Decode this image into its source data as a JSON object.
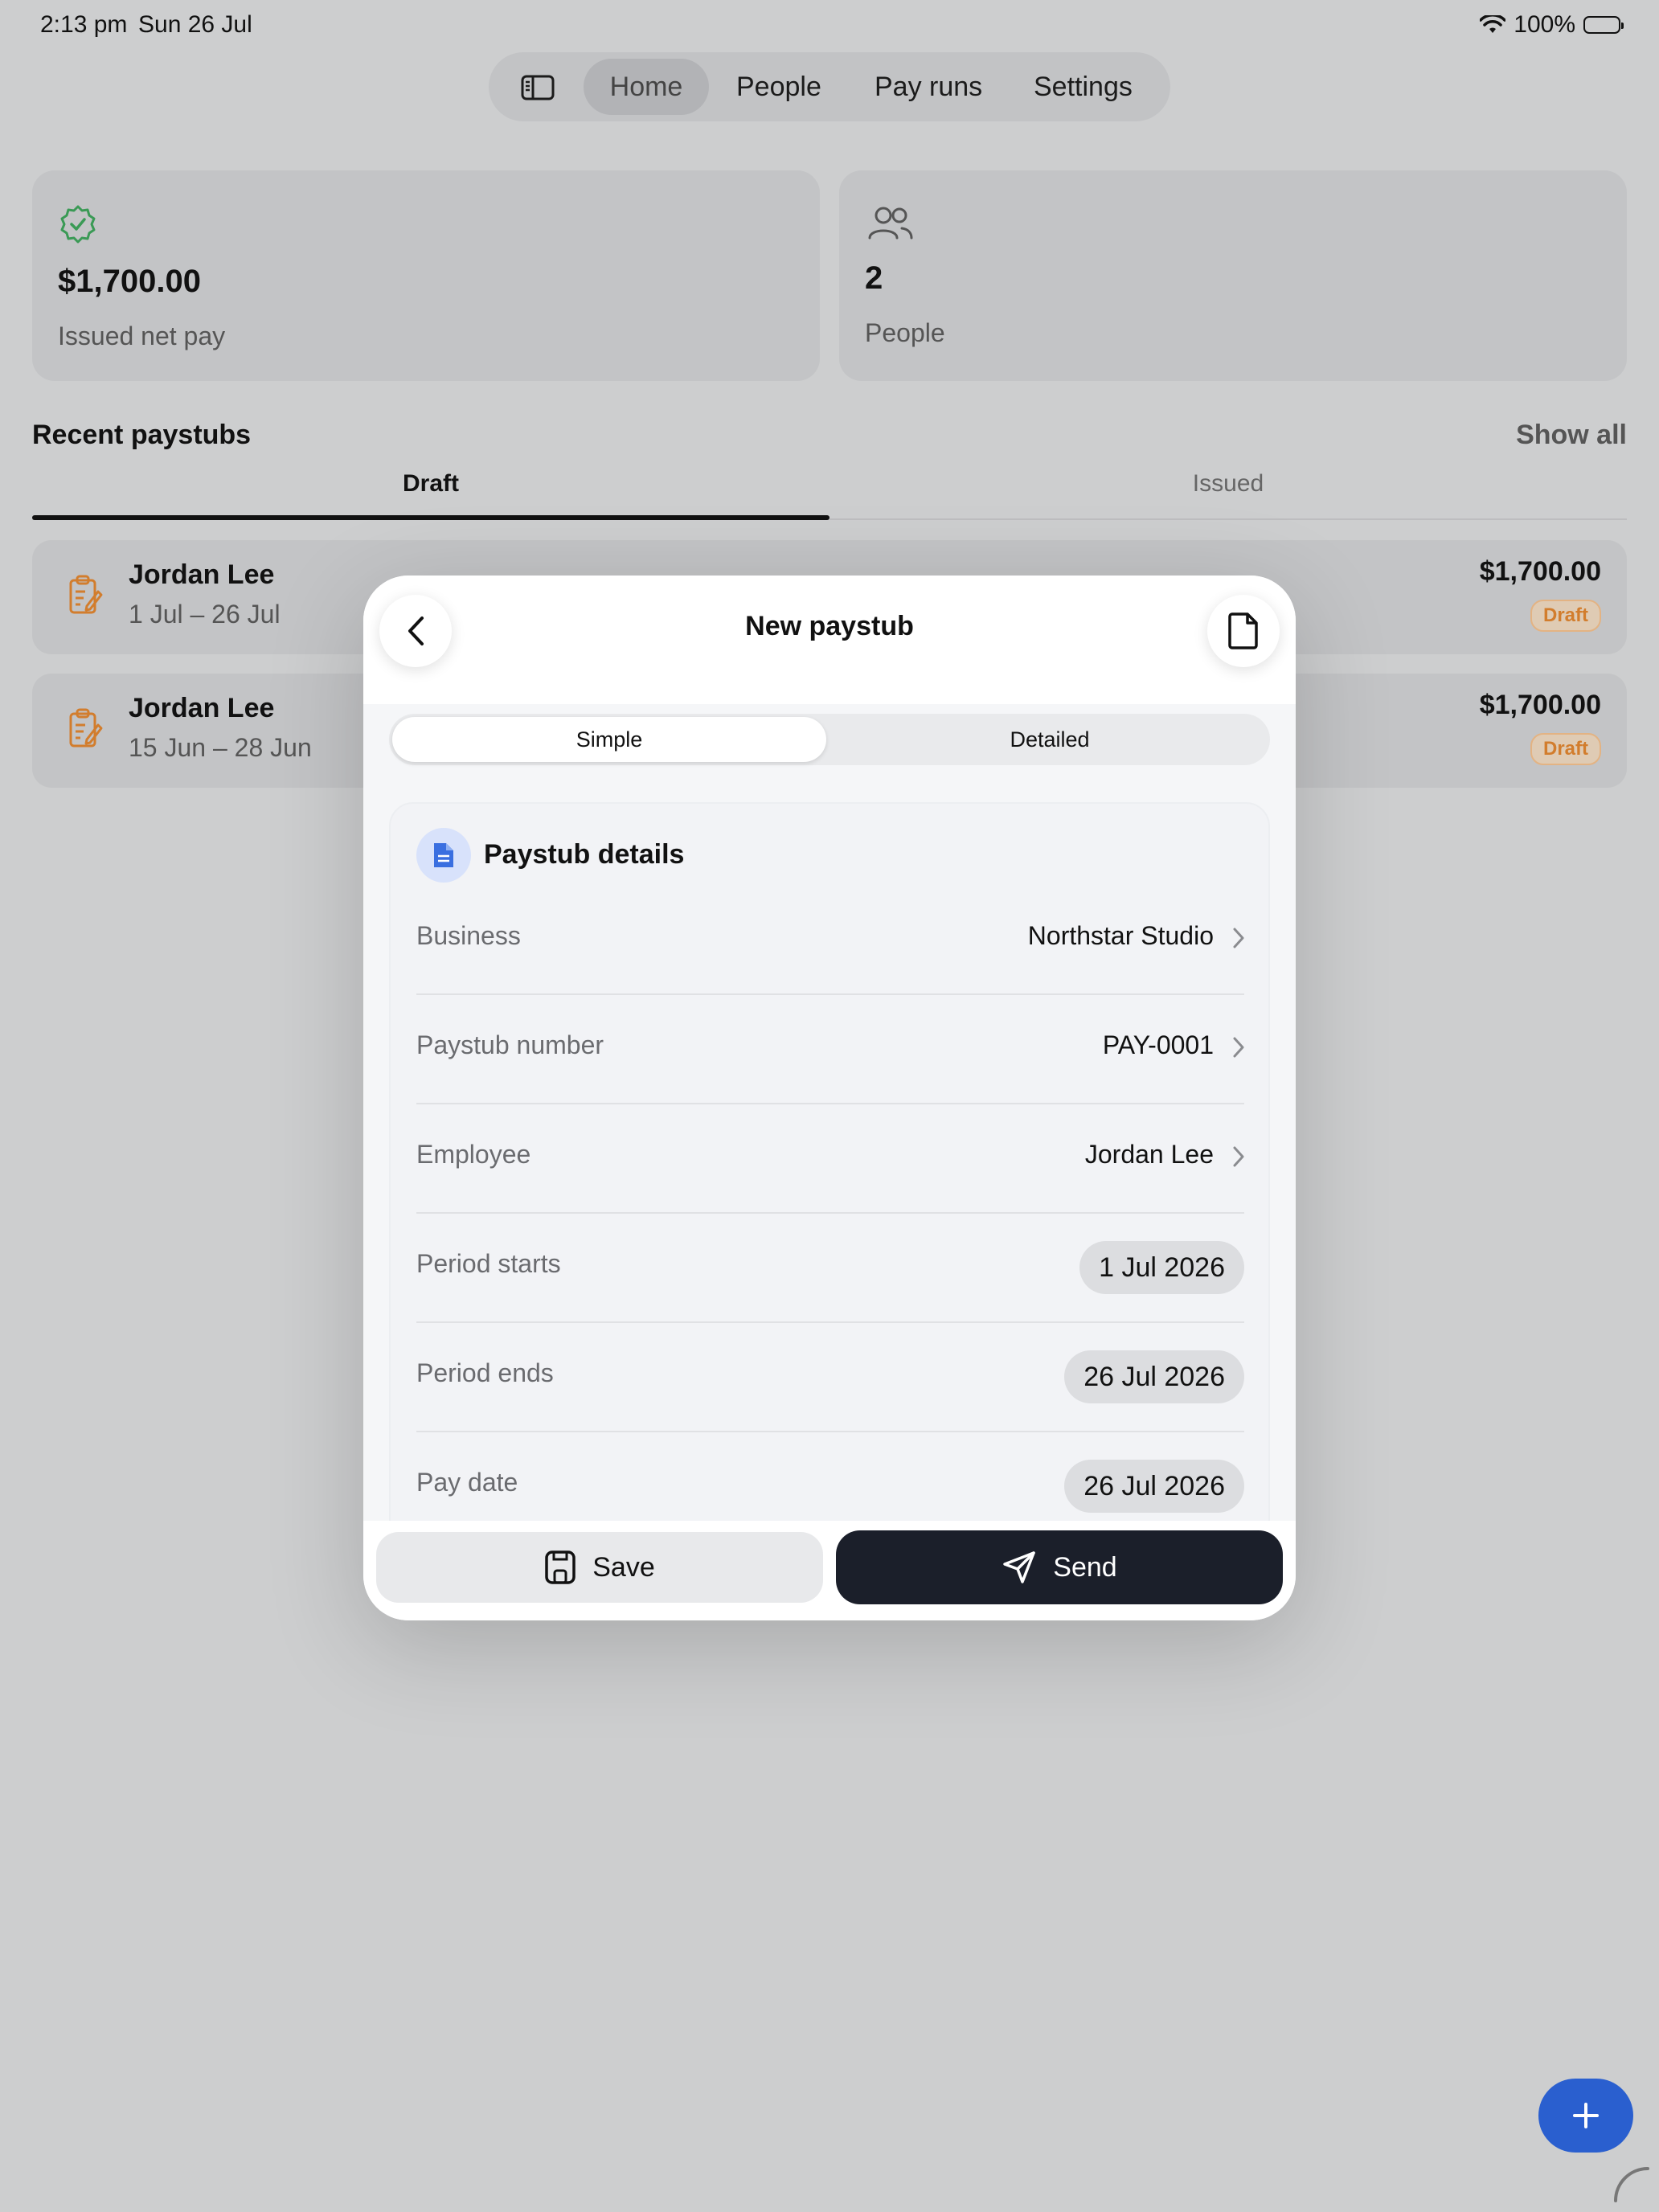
{
  "status_bar": {
    "time": "2:13 pm",
    "date": "Sun 26 Jul",
    "battery": "100%"
  },
  "nav": {
    "items": [
      "Home",
      "People",
      "Pay runs",
      "Settings"
    ],
    "active": "Home"
  },
  "stats": {
    "net_pay": {
      "value": "$1,700.00",
      "label": "Issued net pay",
      "icon": "verified-badge-icon"
    },
    "people": {
      "value": "2",
      "label": "People",
      "icon": "people-icon"
    }
  },
  "recent": {
    "title": "Recent paystubs",
    "show_all": "Show all",
    "tabs": [
      "Draft",
      "Issued"
    ],
    "active_tab": "Draft",
    "rows": [
      {
        "name": "Jordan Lee",
        "dates": "1 Jul – 26 Jul",
        "amount": "$1,700.00",
        "status": "Draft"
      },
      {
        "name": "Jordan Lee",
        "dates": "15 Jun – 28 Jun",
        "amount": "$1,700.00",
        "status": "Draft"
      }
    ]
  },
  "modal": {
    "title": "New paystub",
    "segments": [
      "Simple",
      "Detailed"
    ],
    "active_segment": "Simple",
    "section_title": "Paystub details",
    "fields": [
      {
        "label": "Business",
        "value": "Northstar Studio"
      },
      {
        "label": "Paystub number",
        "value": "PAY-0001"
      },
      {
        "label": "Employee",
        "value": "Jordan Lee"
      },
      {
        "label": "Period starts",
        "value": "1 Jul 2026"
      },
      {
        "label": "Period ends",
        "value": "26 Jul 2026"
      },
      {
        "label": "Pay date",
        "value": "26 Jul 2026"
      }
    ],
    "save_label": "Save",
    "send_label": "Send"
  },
  "colors": {
    "accent": "#2a5fcf",
    "draft": "#d27d2d",
    "send_button": "#1b1f2a",
    "verified": "#3a9a55"
  }
}
